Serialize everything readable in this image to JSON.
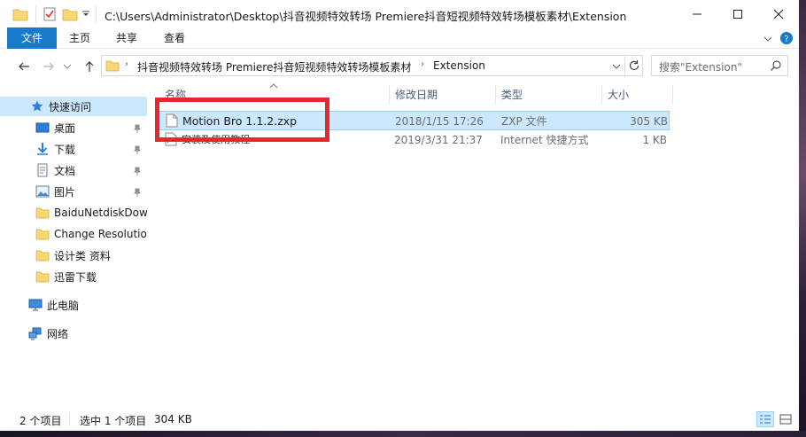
{
  "title": {
    "path": "C:\\Users\\Administrator\\Desktop\\抖音视频特效转场 Premiere抖音短视频特效转场模板素材\\Extension"
  },
  "ribbon": {
    "tabs": [
      "文件",
      "主页",
      "共享",
      "查看"
    ]
  },
  "address": {
    "segments": [
      "抖音视频特效转场 Premiere抖音短视频特效转场模板素材",
      "Extension"
    ]
  },
  "search": {
    "placeholder": "搜索\"Extension\""
  },
  "nav": {
    "quick_access": "快速访问",
    "items": [
      {
        "label": "桌面",
        "icon": "desktop-icon",
        "pinned": true
      },
      {
        "label": "下载",
        "icon": "download-icon",
        "pinned": true
      },
      {
        "label": "文档",
        "icon": "document-icon",
        "pinned": true
      },
      {
        "label": "图片",
        "icon": "picture-icon",
        "pinned": true
      },
      {
        "label": "BaiduNetdiskDow",
        "icon": "folder-icon",
        "pinned": false
      },
      {
        "label": "Change Resolutio",
        "icon": "folder-icon",
        "pinned": false
      },
      {
        "label": "设计类 资料",
        "icon": "folder-icon",
        "pinned": false
      },
      {
        "label": "迅雷下载",
        "icon": "folder-icon",
        "pinned": false
      }
    ],
    "this_pc": "此电脑",
    "network": "网络"
  },
  "columns": {
    "name": "名称",
    "modified": "修改日期",
    "type": "类型",
    "size": "大小"
  },
  "files": [
    {
      "name": "Motion Bro 1.1.2.zxp",
      "modified": "2018/1/15 17:26",
      "type": "ZXP 文件",
      "size": "305 KB"
    },
    {
      "name": "安装及使用教程",
      "modified": "2019/3/31 21:37",
      "type": "Internet 快捷方式",
      "size": "1 KB"
    }
  ],
  "status": {
    "count": "2 个项目",
    "selected": "选中 1 个项目",
    "selected_size": "304 KB"
  },
  "colors": {
    "accent": "#1979ca",
    "selection": "#cce8ff",
    "highlight_box": "#e8262c",
    "folder": "#f8d775"
  }
}
